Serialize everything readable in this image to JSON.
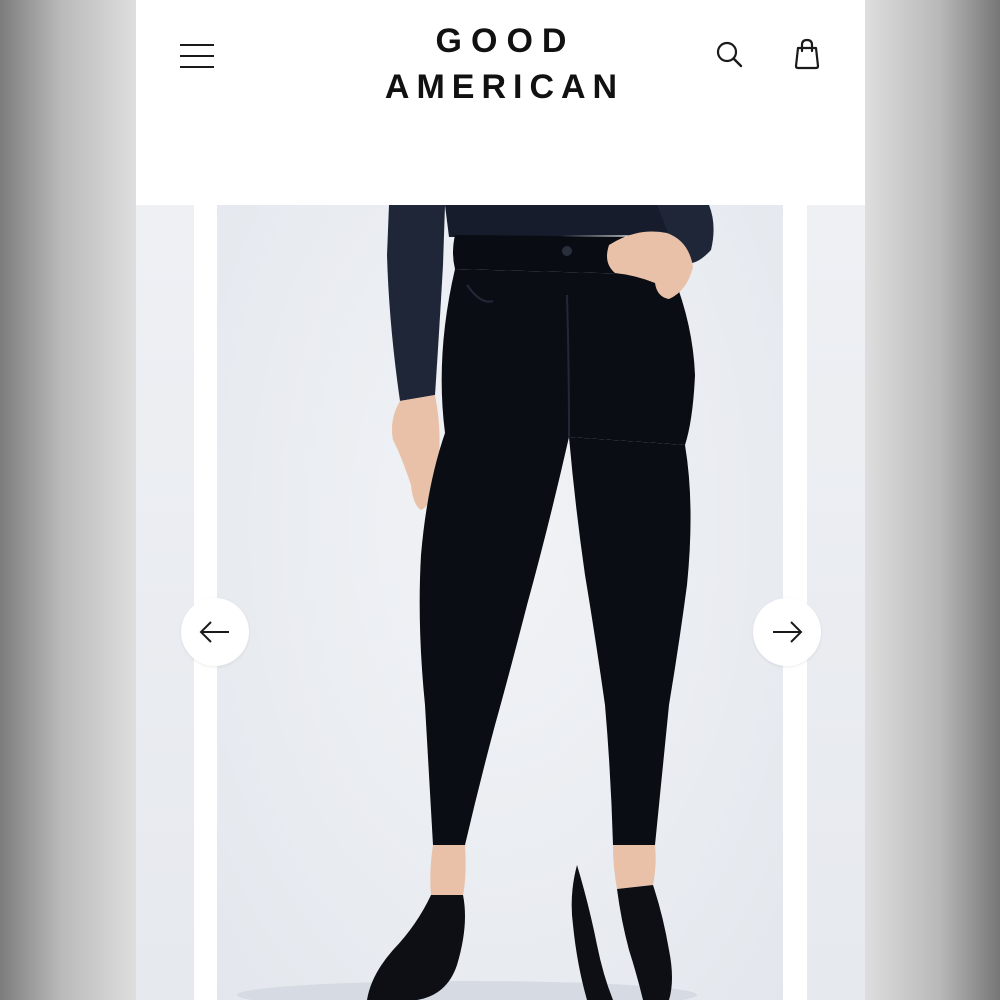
{
  "brand": {
    "line1": "GOOD",
    "line2": "AMERICAN"
  },
  "header": {
    "menu_icon": "hamburger-menu-icon",
    "search_icon": "search-icon",
    "bag_icon": "shopping-bag-icon"
  },
  "carousel": {
    "prev_icon": "arrow-left-icon",
    "next_icon": "arrow-right-icon",
    "image_subject": "model-wearing-black-skinny-jeans"
  },
  "colors": {
    "header_bg": "#ffffff",
    "text": "#111111",
    "denim": "#0b0d14",
    "top": "#1e2536",
    "backdrop": "#e9ecf1"
  }
}
